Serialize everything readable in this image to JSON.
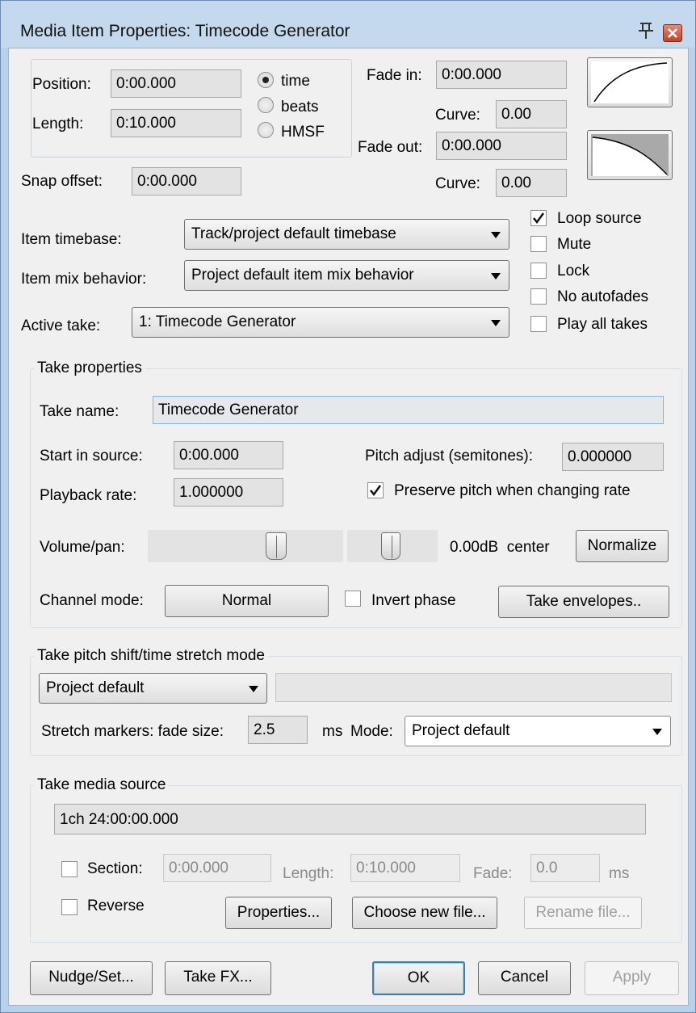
{
  "window": {
    "title": "Media Item Properties:  Timecode Generator",
    "pin_glyph": "平",
    "close_glyph": "x"
  },
  "position": {
    "position_label": "Position:",
    "position_value": "0:00.000",
    "length_label": "Length:",
    "length_value": "0:10.000",
    "radio_time": "time",
    "radio_beats": "beats",
    "radio_hmsf": "HMSF",
    "selected_mode": "time"
  },
  "fades": {
    "fade_in_label": "Fade in:",
    "fade_in_value": "0:00.000",
    "curve_in_label": "Curve:",
    "curve_in_value": "0.00",
    "fade_out_label": "Fade out:",
    "fade_out_value": "0:00.000",
    "curve_out_label": "Curve:",
    "curve_out_value": "0.00",
    "fade_in_shape_icon": "fade-in-curve-icon",
    "fade_out_shape_icon": "fade-out-curve-icon"
  },
  "snap": {
    "label": "Snap offset:",
    "value": "0:00.000"
  },
  "item": {
    "timebase_label": "Item timebase:",
    "timebase_value": "Track/project default timebase",
    "mix_label": "Item mix behavior:",
    "mix_value": "Project default item mix behavior",
    "active_take_label": "Active take:",
    "active_take_value": "1: Timecode Generator"
  },
  "flags": {
    "loop_source": "Loop source",
    "loop_source_checked": true,
    "mute": "Mute",
    "mute_checked": false,
    "lock": "Lock",
    "lock_checked": false,
    "no_autofades": "No autofades",
    "no_autofades_checked": false,
    "play_all_takes": "Play all takes",
    "play_all_takes_checked": false
  },
  "take": {
    "group_title": "Take properties",
    "name_label": "Take name:",
    "name_value": "Timecode Generator",
    "start_label": "Start in source:",
    "start_value": "0:00.000",
    "pitch_label": "Pitch adjust (semitones):",
    "pitch_value": "0.000000",
    "rate_label": "Playback rate:",
    "rate_value": "1.000000",
    "preserve_label": "Preserve pitch when changing rate",
    "preserve_checked": true,
    "volpan_label": "Volume/pan:",
    "volpan_readout": "0.00dB  center",
    "volume_level": 0.5,
    "pan_level": 0.5,
    "normalize_label": "Normalize",
    "channel_label": "Channel mode:",
    "channel_value": "Normal",
    "invert_label": "Invert phase",
    "invert_checked": false,
    "envelopes_label": "Take envelopes.."
  },
  "stretch": {
    "group_title": "Take pitch shift/time stretch mode",
    "mode_value": "Project default",
    "submode_value": "",
    "fade_label": "Stretch markers: fade size:",
    "fade_value": "2.5",
    "fade_unit": "ms",
    "mode_label": "Mode:",
    "marker_mode_value": "Project default"
  },
  "source": {
    "group_title": "Take media source",
    "path_value": "1ch 24:00:00.000",
    "section_label": "Section:",
    "section_checked": false,
    "section_value": "0:00.000",
    "length_label": "Length:",
    "length_value": "0:10.000",
    "fade_label": "Fade:",
    "fade_value": "0.0",
    "fade_unit": "ms",
    "reverse_label": "Reverse",
    "reverse_checked": false,
    "properties_label": "Properties...",
    "choose_label": "Choose new file...",
    "rename_label": "Rename file..."
  },
  "footer": {
    "nudge_label": "Nudge/Set...",
    "takefx_label": "Take FX...",
    "ok_label": "OK",
    "cancel_label": "Cancel",
    "apply_label": "Apply"
  }
}
